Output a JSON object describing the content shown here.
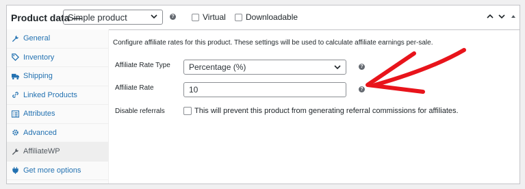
{
  "header": {
    "title": "Product data —",
    "product_type": "Simple product",
    "virtual_label": "Virtual",
    "downloadable_label": "Downloadable"
  },
  "tabs": [
    {
      "label": "General",
      "icon": "wrench-icon"
    },
    {
      "label": "Inventory",
      "icon": "tag-icon"
    },
    {
      "label": "Shipping",
      "icon": "truck-icon"
    },
    {
      "label": "Linked Products",
      "icon": "link-icon"
    },
    {
      "label": "Attributes",
      "icon": "list-icon"
    },
    {
      "label": "Advanced",
      "icon": "gear-icon"
    },
    {
      "label": "AffiliateWP",
      "icon": "wrench-icon",
      "active": true
    },
    {
      "label": "Get more options",
      "icon": "plugin-icon"
    }
  ],
  "main": {
    "intro": "Configure affiliate rates for this product. These settings will be used to calculate affiliate earnings per-sale.",
    "rate_type_label": "Affiliate Rate Type",
    "rate_type_value": "Percentage (%)",
    "rate_label": "Affiliate Rate",
    "rate_value": "10",
    "disable_label": "Disable referrals",
    "disable_text": "This will prevent this product from generating referral commissions for affiliates."
  },
  "colors": {
    "link": "#2271b1",
    "annotation_arrow": "#e8141b"
  }
}
